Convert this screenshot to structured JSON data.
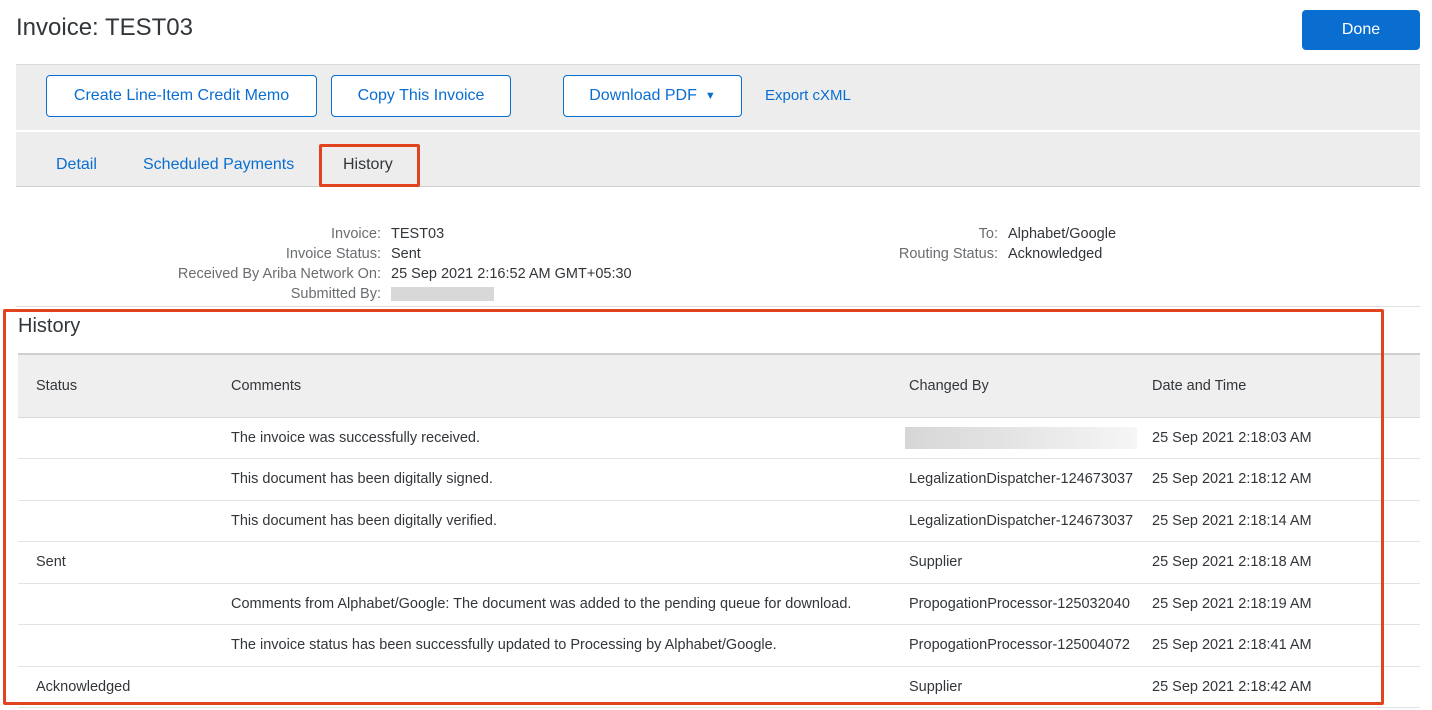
{
  "header": {
    "title": "Invoice: TEST03",
    "done_label": "Done"
  },
  "toolbar": {
    "credit_memo_label": "Create Line-Item Credit Memo",
    "copy_label": "Copy This Invoice",
    "download_label": "Download PDF",
    "export_label": "Export cXML"
  },
  "tabs": [
    {
      "label": "Detail"
    },
    {
      "label": "Scheduled Payments"
    },
    {
      "label": "History"
    }
  ],
  "summary": {
    "invoice_label": "Invoice:",
    "invoice_value": "TEST03",
    "status_label": "Invoice Status:",
    "status_value": "Sent",
    "received_label": "Received By Ariba Network On:",
    "received_value": "25 Sep 2021 2:16:52 AM GMT+05:30",
    "submitted_label": "Submitted By:",
    "to_label": "To:",
    "to_value": "Alphabet/Google",
    "routing_label": "Routing Status:",
    "routing_value": "Acknowledged"
  },
  "history": {
    "title": "History",
    "columns": [
      "Status",
      "Comments",
      "Changed By",
      "Date and Time"
    ],
    "rows": [
      {
        "status": "",
        "comments": "The invoice was successfully received.",
        "changed_by": "",
        "datetime": "25 Sep 2021 2:18:03 AM"
      },
      {
        "status": "",
        "comments": "This document has been digitally signed.",
        "changed_by": "LegalizationDispatcher-124673037",
        "datetime": "25 Sep 2021 2:18:12 AM"
      },
      {
        "status": "",
        "comments": "This document has been digitally verified.",
        "changed_by": "LegalizationDispatcher-124673037",
        "datetime": "25 Sep 2021 2:18:14 AM"
      },
      {
        "status": "Sent",
        "comments": "",
        "changed_by": "Supplier",
        "datetime": "25 Sep 2021 2:18:18 AM"
      },
      {
        "status": "",
        "comments": "Comments from Alphabet/Google: The document was added to the pending queue for download.",
        "changed_by": "PropogationProcessor-125032040",
        "datetime": "25 Sep 2021 2:18:19 AM"
      },
      {
        "status": "",
        "comments": "The invoice status has been successfully updated to Processing by Alphabet/Google.",
        "changed_by": "PropogationProcessor-125004072",
        "datetime": "25 Sep 2021 2:18:41 AM"
      },
      {
        "status": "Acknowledged",
        "comments": "",
        "changed_by": "Supplier",
        "datetime": "25 Sep 2021 2:18:42 AM"
      }
    ]
  },
  "colors": {
    "accent": "#0a6ed1",
    "highlight": "#e2431f",
    "toolbar_bg": "#ededed"
  }
}
